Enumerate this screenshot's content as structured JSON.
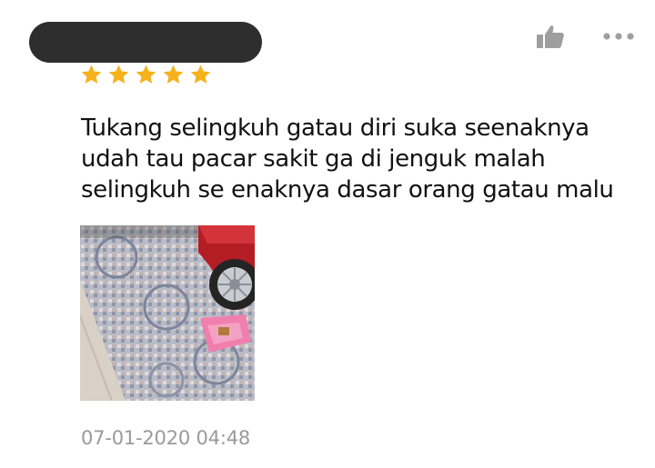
{
  "review": {
    "rating": 5,
    "rating_max": 5,
    "text": "Tukang selingkuh gatau diri suka seenaknya udah tau pacar sakit ga di jenguk malah selingkuh se enaknya dasar orang gatau malu",
    "timestamp": "07-01-2020 04:48"
  },
  "icons": {
    "like": "thumbs-up-icon",
    "more": "more-options-icon",
    "star": "star-icon"
  },
  "colors": {
    "star": "#F6B21B",
    "icon_gray": "#9E9E9E",
    "timestamp_gray": "#9A9A9A",
    "redaction": "#2E2E2E"
  }
}
